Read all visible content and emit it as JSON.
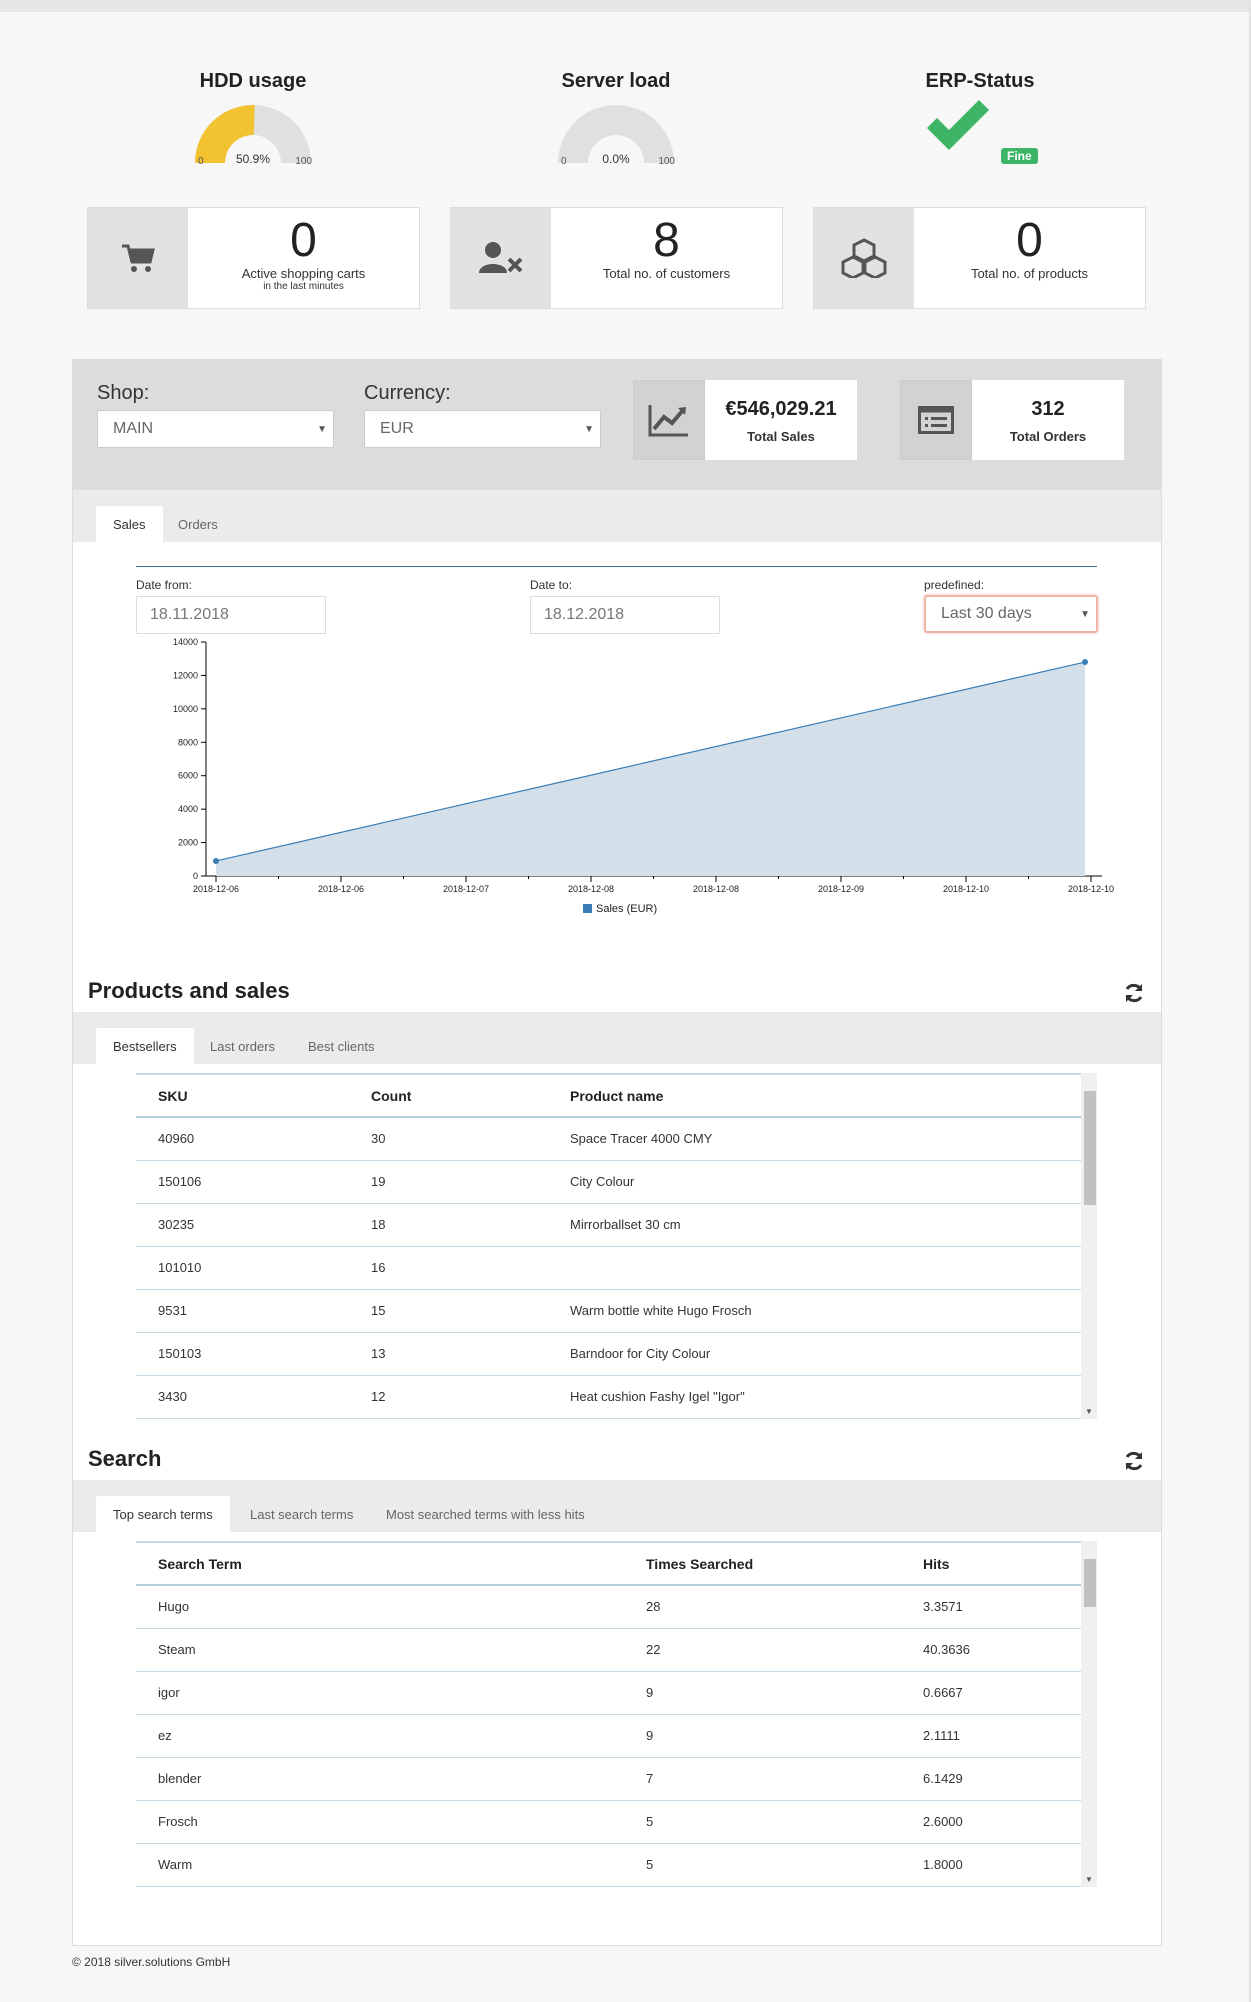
{
  "gauges": [
    {
      "title": "HDD usage",
      "value": "50.9%",
      "fraction": 0.509,
      "min": "0",
      "max": "100",
      "color": "#f2c230"
    },
    {
      "title": "Server load",
      "value": "0.0%",
      "fraction": 0.0,
      "min": "0",
      "max": "100",
      "color": "#f2c230"
    }
  ],
  "erp": {
    "title": "ERP-Status",
    "badge": "Fine",
    "icon": "check-icon",
    "color": "#3eb566"
  },
  "stats": [
    {
      "value": "0",
      "label": "Active shopping carts",
      "sub": "in the last minutes",
      "icon": "cart-icon"
    },
    {
      "value": "8",
      "label": "Total no. of customers",
      "sub": "",
      "icon": "user-remove-icon"
    },
    {
      "value": "0",
      "label": "Total no. of products",
      "sub": "",
      "icon": "boxes-icon"
    }
  ],
  "filters": {
    "shop_label": "Shop:",
    "shop_value": "MAIN",
    "currency_label": "Currency:",
    "currency_value": "EUR"
  },
  "kpis": [
    {
      "value": "€546,029.21",
      "label": "Total Sales",
      "icon": "line-chart-icon"
    },
    {
      "value": "312",
      "label": "Total Orders",
      "icon": "list-icon"
    }
  ],
  "sales_tabs": [
    "Sales",
    "Orders"
  ],
  "dates": {
    "from_label": "Date from:",
    "from_value": "18.11.2018",
    "to_label": "Date to:",
    "to_value": "18.12.2018",
    "predef_label": "predefined:",
    "predef_value": "Last 30 days"
  },
  "chart_data": {
    "type": "area",
    "x": [
      "2018-12-06",
      "2018-12-10"
    ],
    "tick_labels": [
      "2018-12-06",
      "2018-12-06",
      "2018-12-07",
      "2018-12-08",
      "2018-12-08",
      "2018-12-09",
      "2018-12-10",
      "2018-12-10"
    ],
    "series": [
      {
        "name": "Sales (EUR)",
        "values": [
          900,
          12800
        ]
      }
    ],
    "yticks": [
      0,
      2000,
      4000,
      6000,
      8000,
      10000,
      12000,
      14000
    ],
    "ylim": [
      0,
      14000
    ],
    "color": "#3a7db5",
    "fill": "#d3e0ea",
    "legend": "bottom"
  },
  "products": {
    "title": "Products and sales",
    "tabs": [
      "Bestsellers",
      "Last orders",
      "Best clients"
    ],
    "columns": [
      "SKU",
      "Count",
      "Product name"
    ],
    "rows": [
      [
        "40960",
        "30",
        "Space Tracer 4000 CMY"
      ],
      [
        "150106",
        "19",
        "City Colour"
      ],
      [
        "30235",
        "18",
        "Mirrorballset 30 cm"
      ],
      [
        "101010",
        "16",
        ""
      ],
      [
        "9531",
        "15",
        "Warm bottle white Hugo Frosch"
      ],
      [
        "150103",
        "13",
        "Barndoor for City Colour"
      ],
      [
        "3430",
        "12",
        "Heat cushion Fashy Igel \"Igor\""
      ]
    ]
  },
  "search": {
    "title": "Search",
    "tabs": [
      "Top search terms",
      "Last search terms",
      "Most searched terms with less hits"
    ],
    "columns": [
      "Search Term",
      "Times Searched",
      "Hits"
    ],
    "rows": [
      [
        "Hugo",
        "28",
        "3.3571"
      ],
      [
        "Steam",
        "22",
        "40.3636"
      ],
      [
        "igor",
        "9",
        "0.6667"
      ],
      [
        "ez",
        "9",
        "2.1111"
      ],
      [
        "blender",
        "7",
        "6.1429"
      ],
      [
        "Frosch",
        "5",
        "2.6000"
      ],
      [
        "Warm",
        "5",
        "1.8000"
      ]
    ]
  },
  "footer": "© 2018 silver.solutions GmbH"
}
